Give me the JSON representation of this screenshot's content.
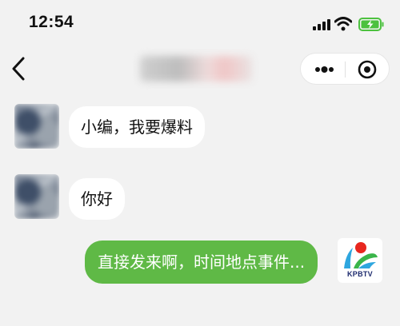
{
  "status_bar": {
    "time": "12:54",
    "icons": [
      "signal-icon",
      "wifi-icon",
      "battery-charging-icon"
    ],
    "battery_color": "#4cc13f"
  },
  "nav": {
    "back_icon": "chevron-left-icon",
    "title": "",
    "capsule_icons": [
      "more-dots-icon",
      "close-circle-icon"
    ]
  },
  "messages": [
    {
      "side": "left",
      "text": "小编，我要爆料"
    },
    {
      "side": "left",
      "text": "你好"
    },
    {
      "side": "right",
      "text": "直接发来啊，时间地点事件..."
    }
  ],
  "self_avatar": {
    "label": "KPBTV",
    "brand_colors": {
      "red": "#e8271f",
      "blue": "#1e2b6e",
      "green": "#3ab54a",
      "light_blue": "#2ea6df"
    }
  },
  "colors": {
    "background": "#f2f2f2",
    "self_bubble": "#5fb946",
    "other_bubble": "#ffffff"
  }
}
